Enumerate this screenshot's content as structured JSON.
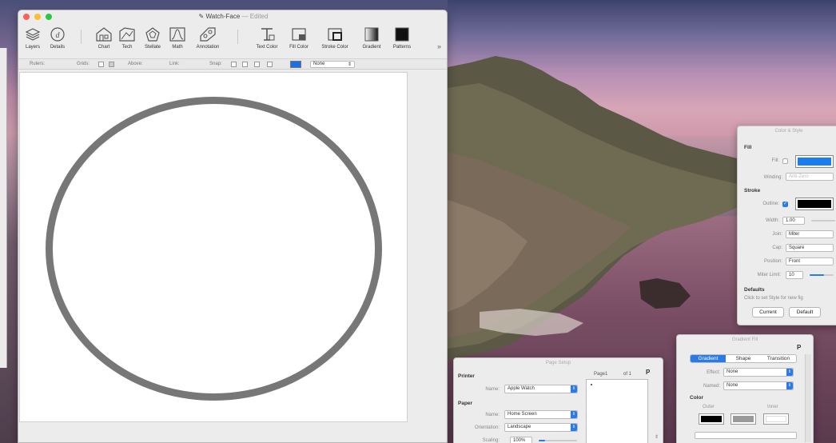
{
  "window": {
    "title": "Watch-Face",
    "edited": "— Edited"
  },
  "toolbar": {
    "items": [
      {
        "label": "Layers",
        "icon": "layers-icon"
      },
      {
        "label": "Details",
        "icon": "details-icon"
      },
      {
        "label": "Chart",
        "icon": "chart-icon"
      },
      {
        "label": "Tech",
        "icon": "tech-icon"
      },
      {
        "label": "Stellate",
        "icon": "stellate-icon"
      },
      {
        "label": "Math",
        "icon": "math-icon"
      },
      {
        "label": "Annotation",
        "icon": "annotation-icon"
      },
      {
        "label": "Text Color",
        "icon": "text-color-icon"
      },
      {
        "label": "Fill Color",
        "icon": "fill-color-icon"
      },
      {
        "label": "Stroke Color",
        "icon": "stroke-color-icon"
      },
      {
        "label": "Gradient",
        "icon": "gradient-icon"
      },
      {
        "label": "Patterns",
        "icon": "patterns-icon"
      }
    ],
    "overflow": "»"
  },
  "optionsbar": {
    "rulers": "Rulers:",
    "grids": "Grids:",
    "above": "Above:",
    "link": "Link:",
    "snap": "Snap:",
    "style_value": "None",
    "style_color": "#1d6fe5"
  },
  "canvas": {
    "shape": "circle",
    "stroke_color": "#777777"
  },
  "color_style": {
    "title": "Color & Style",
    "fill_heading": "Fill",
    "fill_label": "Fill:",
    "fill_color": "#1a7ef0",
    "winding_label": "Winding:",
    "winding_value": "Anti-Zero",
    "stroke_heading": "Stroke",
    "outline_label": "Outline:",
    "outline_checked": true,
    "outline_color": "#000000",
    "width_label": "Width:",
    "width_value": "1.00",
    "join_label": "Join:",
    "join_value": "Miter",
    "cap_label": "Cap:",
    "cap_value": "Square",
    "position_label": "Position:",
    "position_value": "Front",
    "miter_label": "Miter Limit:",
    "miter_value": "10",
    "defaults_heading": "Defaults",
    "defaults_text": "Click to set Style for new fig",
    "current_button": "Current",
    "default_button": "Default"
  },
  "page_setup": {
    "title": "Page Setup",
    "page_label": "Page1",
    "of_label": "of 1",
    "printer_heading": "Printer",
    "printer_name_label": "Name:",
    "printer_name": "Apple Watch",
    "paper_heading": "Paper",
    "paper_name_label": "Name:",
    "paper_name": "Home Screen",
    "orientation_label": "Orientation:",
    "orientation": "Landscape",
    "scaling_label": "Scaling:",
    "scaling": "100%",
    "marker": "P"
  },
  "gradient_fill": {
    "title": "Gradient Fill",
    "marker": "P",
    "tabs": [
      "Gradient",
      "Shape",
      "Transition"
    ],
    "active_tab": 0,
    "effect_label": "Effect:",
    "effect_value": "None",
    "named_label": "Named:",
    "named_value": "None",
    "color_heading": "Color",
    "outer_label": "Outer",
    "inner_label": "Inner",
    "outer_color": "#000000",
    "mid_color": "#9a9a9a",
    "inner_color": "#ffffff"
  }
}
